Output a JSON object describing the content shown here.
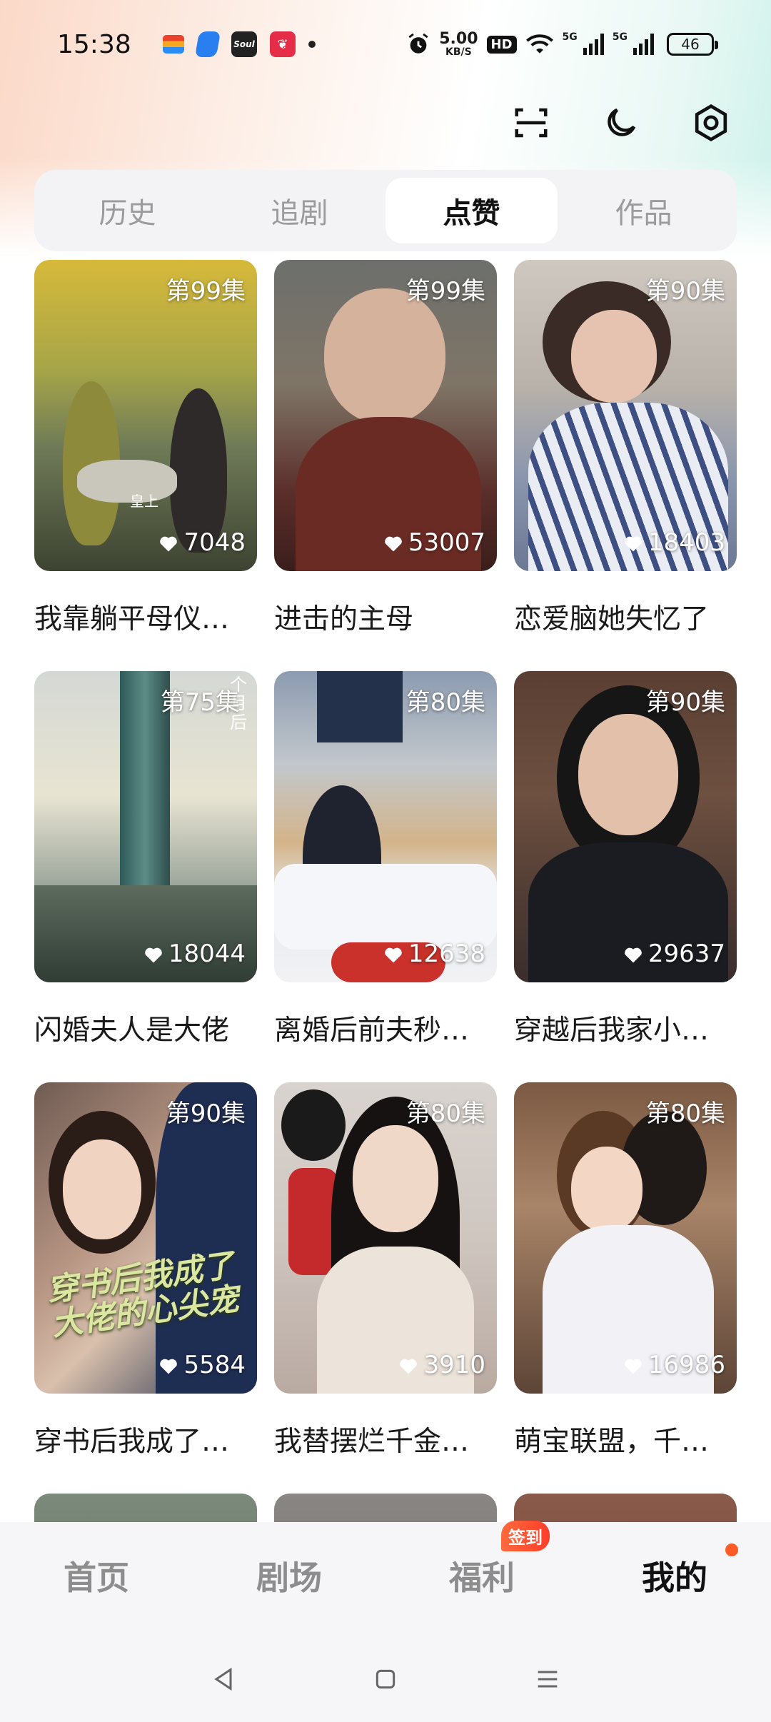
{
  "status_bar": {
    "time": "15:38",
    "speed_value": "5.00",
    "speed_unit": "KB/S",
    "hd": "HD",
    "net1": "5G",
    "net2": "5G",
    "battery": "46"
  },
  "notification_icons": [
    "wallet-icon",
    "app-blue-icon",
    "soul-app-icon",
    "red-app-icon"
  ],
  "soul_label": "Soul",
  "top_actions": [
    "scan-icon",
    "night-mode-icon",
    "settings-icon"
  ],
  "tabs": [
    {
      "label": "历史",
      "active": false
    },
    {
      "label": "追剧",
      "active": false
    },
    {
      "label": "点赞",
      "active": true
    },
    {
      "label": "作品",
      "active": false
    }
  ],
  "cards": [
    {
      "episode": "第99集",
      "likes": "7048",
      "title": "我靠躺平母仪…",
      "overlay": "皇上"
    },
    {
      "episode": "第99集",
      "likes": "53007",
      "title": "进击的主母"
    },
    {
      "episode": "第90集",
      "likes": "18403",
      "title": "恋爱脑她失忆了"
    },
    {
      "episode": "第75集",
      "likes": "18044",
      "title": "闪婚夫人是大佬",
      "overlay": "个月后"
    },
    {
      "episode": "第80集",
      "likes": "12638",
      "title": "离婚后前夫秒…"
    },
    {
      "episode": "第90集",
      "likes": "29637",
      "title": "穿越后我家小…"
    },
    {
      "episode": "第90集",
      "likes": "5584",
      "title": "穿书后我成了…",
      "overlay": "穿书后我成了大佬的心尖宠"
    },
    {
      "episode": "第80集",
      "likes": "3910",
      "title": "我替摆烂千金…"
    },
    {
      "episode": "第80集",
      "likes": "16986",
      "title": "萌宝联盟，千…"
    }
  ],
  "bottom_nav": [
    {
      "label": "首页",
      "active": false
    },
    {
      "label": "剧场",
      "active": false
    },
    {
      "label": "福利",
      "active": false,
      "badge": "签到"
    },
    {
      "label": "我的",
      "active": true
    }
  ],
  "system_nav": [
    "back-icon",
    "home-icon",
    "menu-icon"
  ]
}
